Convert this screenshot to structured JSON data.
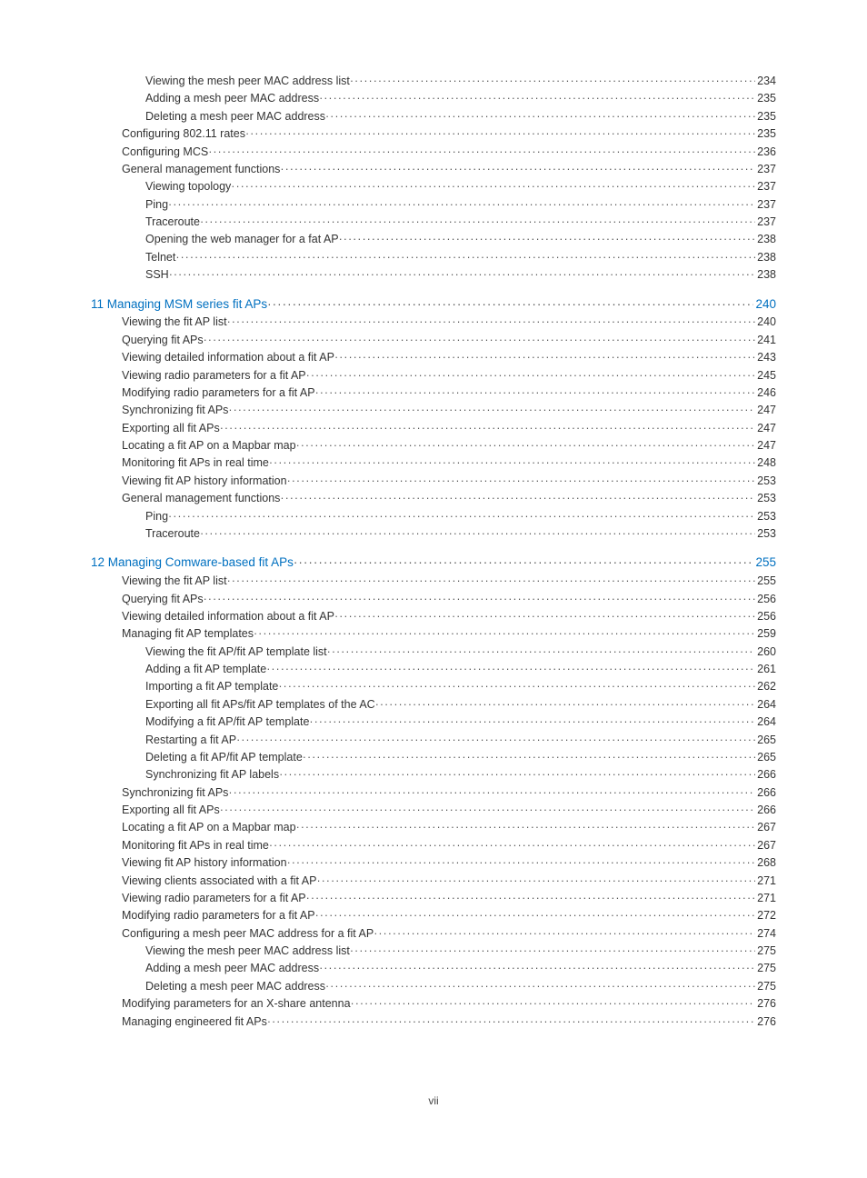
{
  "page_number_label": "vii",
  "toc": [
    {
      "items": [
        {
          "level": 3,
          "title": "Viewing the mesh peer MAC address list",
          "page": "234",
          "link": false
        },
        {
          "level": 3,
          "title": "Adding a mesh peer MAC address",
          "page": "235",
          "link": false
        },
        {
          "level": 3,
          "title": "Deleting a mesh peer MAC address",
          "page": "235",
          "link": false
        },
        {
          "level": 2,
          "title": "Configuring 802.11 rates",
          "page": "235",
          "link": false
        },
        {
          "level": 2,
          "title": "Configuring MCS",
          "page": "236",
          "link": false
        },
        {
          "level": 2,
          "title": "General management functions",
          "page": "237",
          "link": false
        },
        {
          "level": 3,
          "title": "Viewing topology",
          "page": "237",
          "link": false
        },
        {
          "level": 3,
          "title": "Ping",
          "page": "237",
          "link": false
        },
        {
          "level": 3,
          "title": "Traceroute",
          "page": "237",
          "link": false
        },
        {
          "level": 3,
          "title": "Opening the web manager for a fat AP",
          "page": "238",
          "link": false
        },
        {
          "level": 3,
          "title": "Telnet",
          "page": "238",
          "link": false
        },
        {
          "level": 3,
          "title": "SSH",
          "page": "238",
          "link": false
        }
      ]
    },
    {
      "items": [
        {
          "level": 1,
          "title": "11 Managing MSM series fit APs",
          "page": "240",
          "link": true
        },
        {
          "level": 2,
          "title": "Viewing the fit AP list",
          "page": "240",
          "link": false
        },
        {
          "level": 2,
          "title": "Querying fit APs",
          "page": "241",
          "link": false
        },
        {
          "level": 2,
          "title": "Viewing detailed information about a fit AP",
          "page": "243",
          "link": false
        },
        {
          "level": 2,
          "title": "Viewing radio parameters for a fit AP",
          "page": "245",
          "link": false
        },
        {
          "level": 2,
          "title": "Modifying radio parameters for a fit AP",
          "page": "246",
          "link": false
        },
        {
          "level": 2,
          "title": "Synchronizing fit APs",
          "page": "247",
          "link": false
        },
        {
          "level": 2,
          "title": "Exporting all fit APs",
          "page": "247",
          "link": false
        },
        {
          "level": 2,
          "title": "Locating a fit AP on a Mapbar map",
          "page": "247",
          "link": false
        },
        {
          "level": 2,
          "title": "Monitoring fit APs in real time",
          "page": "248",
          "link": false
        },
        {
          "level": 2,
          "title": "Viewing fit AP history information",
          "page": "253",
          "link": false
        },
        {
          "level": 2,
          "title": "General management functions",
          "page": "253",
          "link": false
        },
        {
          "level": 3,
          "title": "Ping",
          "page": "253",
          "link": false
        },
        {
          "level": 3,
          "title": "Traceroute",
          "page": "253",
          "link": false
        }
      ]
    },
    {
      "items": [
        {
          "level": 1,
          "title": "12 Managing Comware-based fit APs",
          "page": "255",
          "link": true
        },
        {
          "level": 2,
          "title": "Viewing the fit AP list",
          "page": "255",
          "link": false
        },
        {
          "level": 2,
          "title": "Querying fit APs",
          "page": "256",
          "link": false
        },
        {
          "level": 2,
          "title": "Viewing detailed information about a fit AP",
          "page": "256",
          "link": false
        },
        {
          "level": 2,
          "title": "Managing fit AP templates",
          "page": "259",
          "link": false
        },
        {
          "level": 3,
          "title": "Viewing the fit AP/fit AP template list",
          "page": "260",
          "link": false
        },
        {
          "level": 3,
          "title": "Adding a fit AP template",
          "page": "261",
          "link": false
        },
        {
          "level": 3,
          "title": "Importing a fit AP template",
          "page": "262",
          "link": false
        },
        {
          "level": 3,
          "title": "Exporting all fit APs/fit AP templates of the AC",
          "page": "264",
          "link": false
        },
        {
          "level": 3,
          "title": "Modifying a fit AP/fit AP template",
          "page": "264",
          "link": false
        },
        {
          "level": 3,
          "title": "Restarting a fit AP",
          "page": "265",
          "link": false
        },
        {
          "level": 3,
          "title": "Deleting a fit AP/fit AP template",
          "page": "265",
          "link": false
        },
        {
          "level": 3,
          "title": "Synchronizing fit AP labels",
          "page": "266",
          "link": false
        },
        {
          "level": 2,
          "title": "Synchronizing fit APs",
          "page": "266",
          "link": false
        },
        {
          "level": 2,
          "title": "Exporting all fit APs",
          "page": "266",
          "link": false
        },
        {
          "level": 2,
          "title": "Locating a fit AP on a Mapbar map",
          "page": "267",
          "link": false
        },
        {
          "level": 2,
          "title": "Monitoring fit APs in real time",
          "page": "267",
          "link": false
        },
        {
          "level": 2,
          "title": "Viewing fit AP history information",
          "page": "268",
          "link": false
        },
        {
          "level": 2,
          "title": "Viewing clients associated with a fit AP",
          "page": "271",
          "link": false
        },
        {
          "level": 2,
          "title": "Viewing radio parameters for a fit AP",
          "page": "271",
          "link": false
        },
        {
          "level": 2,
          "title": "Modifying radio parameters for a fit AP",
          "page": "272",
          "link": false
        },
        {
          "level": 2,
          "title": "Configuring a mesh peer MAC address for a fit AP",
          "page": "274",
          "link": false
        },
        {
          "level": 3,
          "title": "Viewing the mesh peer MAC address list",
          "page": "275",
          "link": false
        },
        {
          "level": 3,
          "title": "Adding a mesh peer MAC address",
          "page": "275",
          "link": false
        },
        {
          "level": 3,
          "title": "Deleting a mesh peer MAC address",
          "page": "275",
          "link": false
        },
        {
          "level": 2,
          "title": "Modifying parameters for an X-share antenna",
          "page": "276",
          "link": false
        },
        {
          "level": 2,
          "title": "Managing engineered fit APs",
          "page": "276",
          "link": false
        }
      ]
    }
  ]
}
